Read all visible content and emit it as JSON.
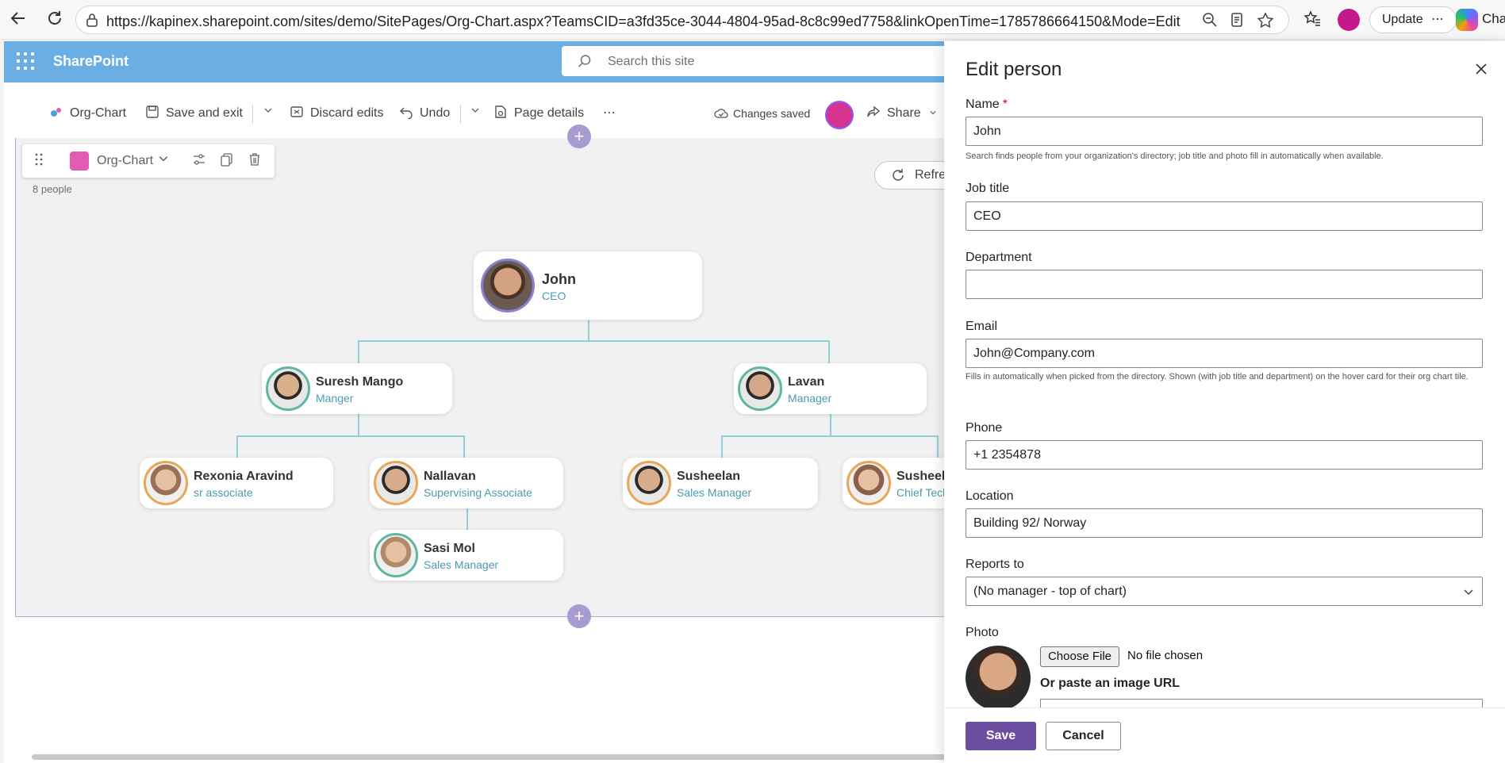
{
  "browser": {
    "url": "https://kapinex.sharepoint.com/sites/demo/SitePages/Org-Chart.aspx?TeamsCID=a3fd35ce-3044-4804-95ad-8c8c99ed7758&linkOpenTime=1785786664150&Mode=Edit",
    "update_label": "Update",
    "update_more": "⋯",
    "chat_label": "Cha"
  },
  "sharepoint": {
    "title": "SharePoint",
    "search_placeholder": "Search this site"
  },
  "commandbar": {
    "page_name": "Org-Chart",
    "save_exit": "Save and exit",
    "discard": "Discard edits",
    "undo": "Undo",
    "page_details": "Page details",
    "more": "⋯",
    "changes_saved": "Changes saved",
    "share": "Share"
  },
  "webpart": {
    "name": "Org-Chart",
    "people_count": "8 people",
    "refresh_label": "Refre"
  },
  "org": {
    "ceo": {
      "name": "John",
      "title": "CEO"
    },
    "m1": {
      "name": "Suresh Mango",
      "title": "Manger"
    },
    "m2": {
      "name": "Lavan",
      "title": "Manager"
    },
    "e1": {
      "name": "Rexonia Aravind",
      "title": "sr associate"
    },
    "e2": {
      "name": "Nallavan",
      "title": "Supervising Associate"
    },
    "e3": {
      "name": "Susheelan",
      "title": "Sales Manager"
    },
    "e4": {
      "name": "Susheela",
      "title": "Chief Tech"
    },
    "e5": {
      "name": "Sasi Mol",
      "title": "Sales Manager"
    }
  },
  "panel": {
    "title": "Edit person",
    "name_label": "Name",
    "name_required": "*",
    "name_value": "John",
    "name_hint": "Search finds people from your organization's directory; job title and photo fill in automatically when available.",
    "job_label": "Job title",
    "job_value": "CEO",
    "dept_label": "Department",
    "dept_value": "",
    "email_label": "Email",
    "email_value": "John@Company.com",
    "email_hint": "Fills in automatically when picked from the directory. Shown (with job title and department) on the hover card for their org chart tile.",
    "phone_label": "Phone",
    "phone_value": "+1 2354878",
    "location_label": "Location",
    "location_value": "Building 92/ Norway",
    "reports_label": "Reports to",
    "reports_value": "(No manager - top of chart)",
    "photo_label": "Photo",
    "choose_file": "Choose File",
    "no_file": "No file chosen",
    "paste_url": "Or paste an image URL",
    "save": "Save",
    "cancel": "Cancel"
  }
}
